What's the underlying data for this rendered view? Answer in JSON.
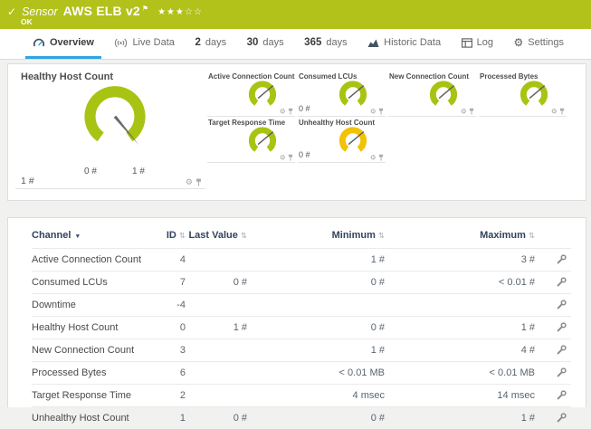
{
  "header": {
    "check": "✓",
    "kind": "Sensor",
    "title": "AWS ELB v2",
    "flag": "⚑",
    "stars": "★★★☆☆",
    "status": "OK"
  },
  "tabs": [
    {
      "label": "Overview",
      "icon": "gauge-icon",
      "active": true
    },
    {
      "label": "Live Data",
      "icon": "signal-icon",
      "active": false
    },
    {
      "num": "2",
      "label": "days",
      "active": false
    },
    {
      "num": "30",
      "label": "days",
      "active": false
    },
    {
      "num": "365",
      "label": "days",
      "active": false
    },
    {
      "label": "Historic Data",
      "icon": "chart-icon",
      "active": false
    },
    {
      "label": "Log",
      "icon": "log-icon",
      "active": false
    },
    {
      "label": "Settings",
      "icon": "gear-icon",
      "active": false
    }
  ],
  "gauges": {
    "primary": {
      "title": "Healthy Host Count",
      "value": "1 #",
      "scale_start": "0 #",
      "scale_end": "1 #",
      "color": "#a9c313",
      "icons": [
        "gear-icon",
        "pin-icon"
      ]
    },
    "secondary": [
      {
        "title": "Active Connection Count",
        "value": "",
        "color": "#a9c313"
      },
      {
        "title": "Consumed LCUs",
        "value": "0 #",
        "color": "#a9c313"
      },
      {
        "title": "New Connection Count",
        "value": "",
        "color": "#a9c313"
      },
      {
        "title": "Processed Bytes",
        "value": "",
        "color": "#a9c313"
      },
      {
        "title": "Target Response Time",
        "value": "",
        "color": "#a9c313"
      },
      {
        "title": "Unhealthy Host Count",
        "value": "0 #",
        "color": "#f2c204"
      }
    ]
  },
  "table": {
    "columns": [
      {
        "label": "Channel",
        "sorted": "desc"
      },
      {
        "label": "ID"
      },
      {
        "label": "Last Value"
      },
      {
        "label": "Minimum"
      },
      {
        "label": "Maximum"
      }
    ],
    "row_action_icon": "wrench-gear-icon",
    "rows": [
      {
        "channel": "Active Connection Count",
        "id": "4",
        "last": "",
        "min": "1 #",
        "max": "3 #"
      },
      {
        "channel": "Consumed LCUs",
        "id": "7",
        "last": "0 #",
        "min": "0 #",
        "max": "< 0.01 #"
      },
      {
        "channel": "Downtime",
        "id": "-4",
        "last": "",
        "min": "",
        "max": ""
      },
      {
        "channel": "Healthy Host Count",
        "id": "0",
        "last": "1 #",
        "min": "0 #",
        "max": "1 #"
      },
      {
        "channel": "New Connection Count",
        "id": "3",
        "last": "",
        "min": "1 #",
        "max": "4 #"
      },
      {
        "channel": "Processed Bytes",
        "id": "6",
        "last": "",
        "min": "< 0.01 MB",
        "max": "< 0.01 MB"
      },
      {
        "channel": "Target Response Time",
        "id": "2",
        "last": "",
        "min": "4 msec",
        "max": "14 msec"
      },
      {
        "channel": "Unhealthy Host Count",
        "id": "1",
        "last": "0 #",
        "min": "0 #",
        "max": "1 #"
      }
    ]
  },
  "colors": {
    "brand_green": "#b3c11b",
    "gauge_green": "#a9c313",
    "warning_yellow": "#f2c204",
    "tab_underline": "#2ea7e0",
    "header_text": "#31445c"
  }
}
